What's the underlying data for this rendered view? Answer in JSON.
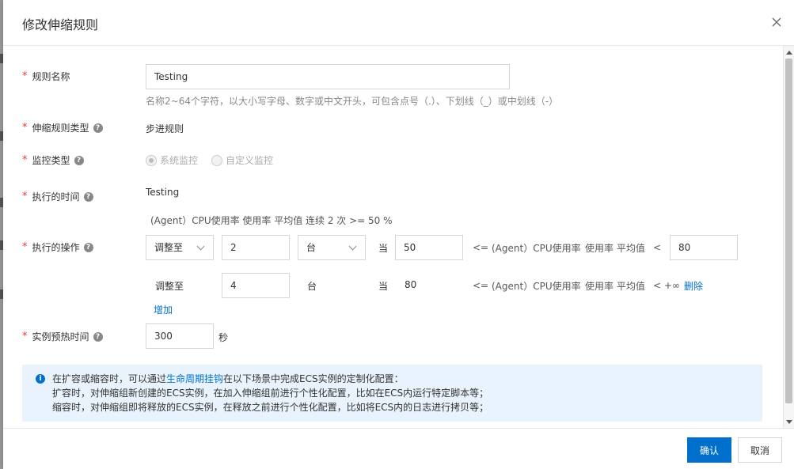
{
  "dialog": {
    "title": "修改伸缩规则",
    "close_icon": "close-icon"
  },
  "form": {
    "rule_name": {
      "label": "规则名称",
      "value": "Testing",
      "hint": "名称2~64个字符，以大小写字母、数字或中文开头，可包含点号（.）、下划线（_）或中划线（-）"
    },
    "rule_type": {
      "label": "伸缩规则类型",
      "value": "步进规则"
    },
    "monitor_type": {
      "label": "监控类型",
      "options": [
        "系统监控",
        "自定义监控"
      ],
      "selected": "系统监控"
    },
    "exec_time": {
      "label": "执行的时间",
      "value": "Testing",
      "condition": "(Agent）CPU使用率 使用率 平均值 连续 2 次 >= 50 %"
    },
    "exec_action": {
      "label": "执行的操作",
      "row1": {
        "adjust": "调整至",
        "count": "2",
        "unit": "台",
        "when": "当",
        "lower": "50",
        "op_le": "<=",
        "metric": "(Agent）CPU使用率",
        "stat": "使用率 平均值",
        "op_lt": "<",
        "upper": "80"
      },
      "row2": {
        "adjust": "调整至",
        "count": "4",
        "unit": "台",
        "when": "当",
        "lower": "80",
        "op_le": "<=",
        "metric": "(Agent）CPU使用率",
        "stat": "使用率 平均值",
        "op_lt": "< +∞",
        "delete": "删除"
      },
      "add": "增加"
    },
    "warmup": {
      "label": "实例预热时间",
      "value": "300",
      "unit": "秒"
    }
  },
  "notice": {
    "line1_prefix": "在扩容或缩容时，可以通过",
    "line1_link": "生命周期挂钩",
    "line1_suffix": "在以下场景中完成ECS实例的定制化配置：",
    "line2": "扩容时，对伸缩组新创建的ECS实例，在加入伸缩组前进行个性化配置，比如在ECS内运行特定脚本等；",
    "line3": "缩容时，对伸缩组即将释放的ECS实例，在释放之前进行个性化配置，比如将ECS内的日志进行拷贝等；"
  },
  "footer": {
    "confirm": "确认",
    "cancel": "取消"
  },
  "colors": {
    "primary": "#0070cc",
    "required": "#e23b2e",
    "notice_bg": "#e8f3fd"
  }
}
